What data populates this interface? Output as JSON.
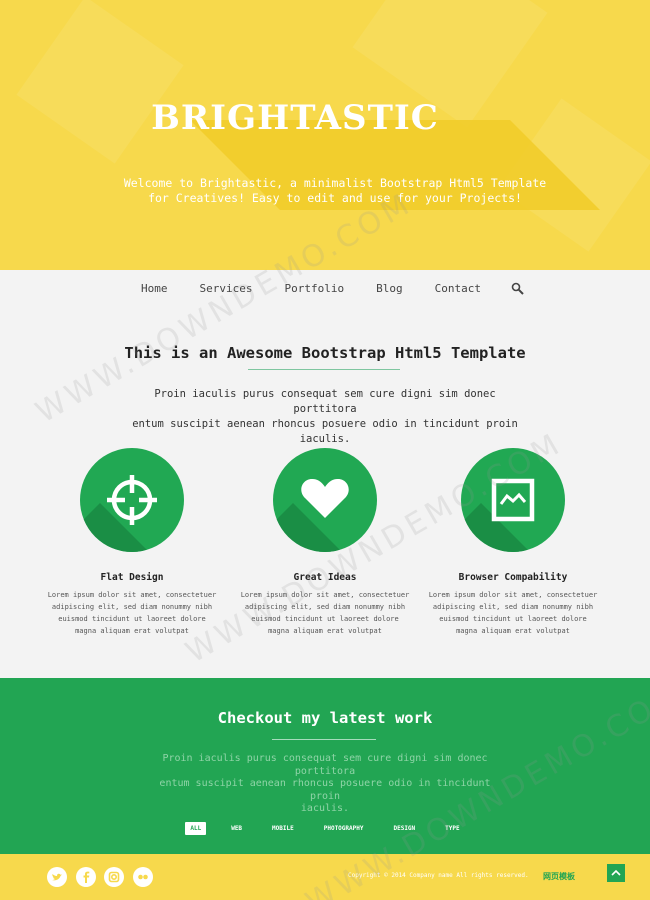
{
  "hero": {
    "brand": "BRIGHTASTIC",
    "tagline_line1": "Welcome to Brightastic, a minimalist Bootstrap Html5 Template",
    "tagline_line2": "for Creatives! Easy to edit and use for your Projects!"
  },
  "nav": {
    "items": [
      "Home",
      "Services",
      "Portfolio",
      "Blog",
      "Contact"
    ],
    "search_icon": "search-icon"
  },
  "intro": {
    "title": "This is an Awesome Bootstrap Html5 Template",
    "text_line1": "Proin iaculis purus consequat sem cure digni sim donec porttitora",
    "text_line2": "entum suscipit aenean rhoncus posuere odio in tincidunt proin iaculis."
  },
  "features": [
    {
      "icon": "target-icon",
      "title": "Flat Design",
      "lines": [
        "Lorem ipsum dolor sit amet, consectetuer",
        "adipiscing elit, sed diam nonummy nibh",
        "euismod tincidunt ut laoreet dolore",
        "magna aliquam erat volutpat"
      ]
    },
    {
      "icon": "heart-icon",
      "title": "Great Ideas",
      "lines": [
        "Lorem ipsum dolor sit amet, consectetuer",
        "adipiscing elit, sed diam nonummy nibh",
        "euismod tincidunt ut laoreet dolore",
        "magna aliquam erat volutpat"
      ]
    },
    {
      "icon": "browser-chart-icon",
      "title": "Browser Compability",
      "lines": [
        "Lorem ipsum dolor sit amet, consectetuer",
        "adipiscing elit, sed diam nonummy nibh",
        "euismod tincidunt ut laoreet dolore",
        "magna aliquam erat volutpat"
      ]
    }
  ],
  "work": {
    "title": "Checkout my latest work",
    "text_line1": "Proin iaculis purus consequat sem cure digni sim donec porttitora",
    "text_line2": "entum suscipit aenean rhoncus posuere odio in tincidunt proin",
    "text_line3": "iaculis.",
    "filters": [
      "ALL",
      "WEB",
      "MOBILE",
      "PHOTOGRAPHY",
      "DESIGN",
      "TYPE"
    ],
    "active_filter": "ALL"
  },
  "footer": {
    "social": [
      "twitter-icon",
      "facebook-icon",
      "instagram-icon",
      "flickr-icon"
    ],
    "copyright": "Copyright © 2014 Company name All rights reserved.",
    "brand_cn": "网页模板",
    "to_top_icon": "arrow-up-icon"
  },
  "watermark": "WWW.DOWNDEMO.COM",
  "colors": {
    "yellow": "#f7d94c",
    "green": "#22a553",
    "background": "#f3f3f3"
  }
}
